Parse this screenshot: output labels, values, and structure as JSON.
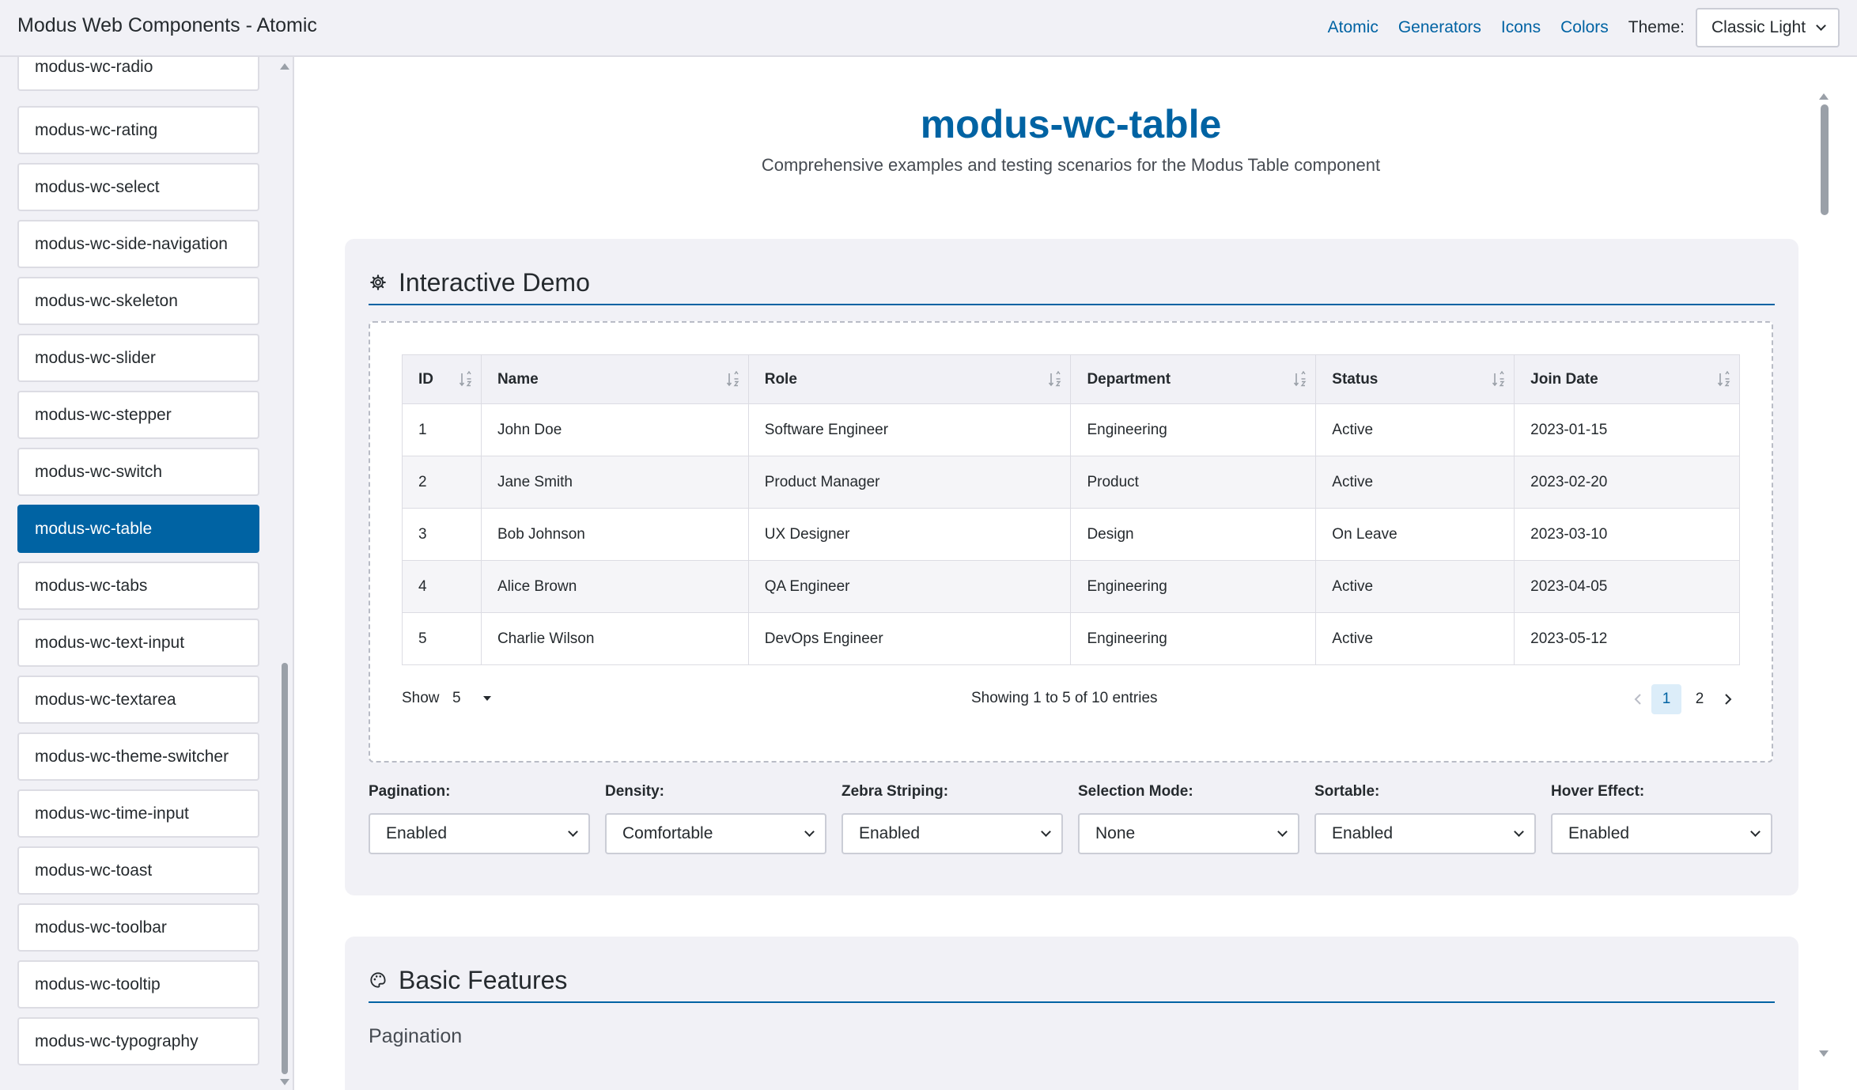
{
  "header": {
    "app_title": "Modus Web Components - Atomic",
    "nav": [
      "Atomic",
      "Generators",
      "Icons",
      "Colors"
    ],
    "theme_label": "Theme:",
    "theme_value": "Classic Light"
  },
  "sidebar": {
    "items": [
      {
        "label": "modus-wc-radio",
        "active": false
      },
      {
        "label": "modus-wc-rating",
        "active": false
      },
      {
        "label": "modus-wc-select",
        "active": false
      },
      {
        "label": "modus-wc-side-navigation",
        "active": false
      },
      {
        "label": "modus-wc-skeleton",
        "active": false
      },
      {
        "label": "modus-wc-slider",
        "active": false
      },
      {
        "label": "modus-wc-stepper",
        "active": false
      },
      {
        "label": "modus-wc-switch",
        "active": false
      },
      {
        "label": "modus-wc-table",
        "active": true
      },
      {
        "label": "modus-wc-tabs",
        "active": false
      },
      {
        "label": "modus-wc-text-input",
        "active": false
      },
      {
        "label": "modus-wc-textarea",
        "active": false
      },
      {
        "label": "modus-wc-theme-switcher",
        "active": false
      },
      {
        "label": "modus-wc-time-input",
        "active": false
      },
      {
        "label": "modus-wc-toast",
        "active": false
      },
      {
        "label": "modus-wc-toolbar",
        "active": false
      },
      {
        "label": "modus-wc-tooltip",
        "active": false
      },
      {
        "label": "modus-wc-typography",
        "active": false
      }
    ]
  },
  "main": {
    "title": "modus-wc-table",
    "subtitle": "Comprehensive examples and testing scenarios for the Modus Table component",
    "interactive_demo": {
      "heading": "Interactive Demo",
      "icon": "gear-icon",
      "table": {
        "columns": [
          "ID",
          "Name",
          "Role",
          "Department",
          "Status",
          "Join Date"
        ],
        "rows": [
          [
            "1",
            "John Doe",
            "Software Engineer",
            "Engineering",
            "Active",
            "2023-01-15"
          ],
          [
            "2",
            "Jane Smith",
            "Product Manager",
            "Product",
            "Active",
            "2023-02-20"
          ],
          [
            "3",
            "Bob Johnson",
            "UX Designer",
            "Design",
            "On Leave",
            "2023-03-10"
          ],
          [
            "4",
            "Alice Brown",
            "QA Engineer",
            "Engineering",
            "Active",
            "2023-04-05"
          ],
          [
            "5",
            "Charlie Wilson",
            "DevOps Engineer",
            "Engineering",
            "Active",
            "2023-05-12"
          ]
        ]
      },
      "footer": {
        "show_label": "Show",
        "show_value": "5",
        "entries_text": "Showing 1 to 5 of 10 entries",
        "pages": [
          "1",
          "2"
        ],
        "current_page": "1"
      },
      "controls": [
        {
          "label": "Pagination:",
          "value": "Enabled"
        },
        {
          "label": "Density:",
          "value": "Comfortable"
        },
        {
          "label": "Zebra Striping:",
          "value": "Enabled"
        },
        {
          "label": "Selection Mode:",
          "value": "None"
        },
        {
          "label": "Sortable:",
          "value": "Enabled"
        },
        {
          "label": "Hover Effect:",
          "value": "Enabled"
        }
      ]
    },
    "basic_features": {
      "heading": "Basic Features",
      "icon": "palette-icon",
      "subheading": "Pagination"
    }
  },
  "colors": {
    "accent": "#0063a3",
    "surface": "#f1f1f6",
    "border": "#dcdce3",
    "text": "#252a2e"
  }
}
